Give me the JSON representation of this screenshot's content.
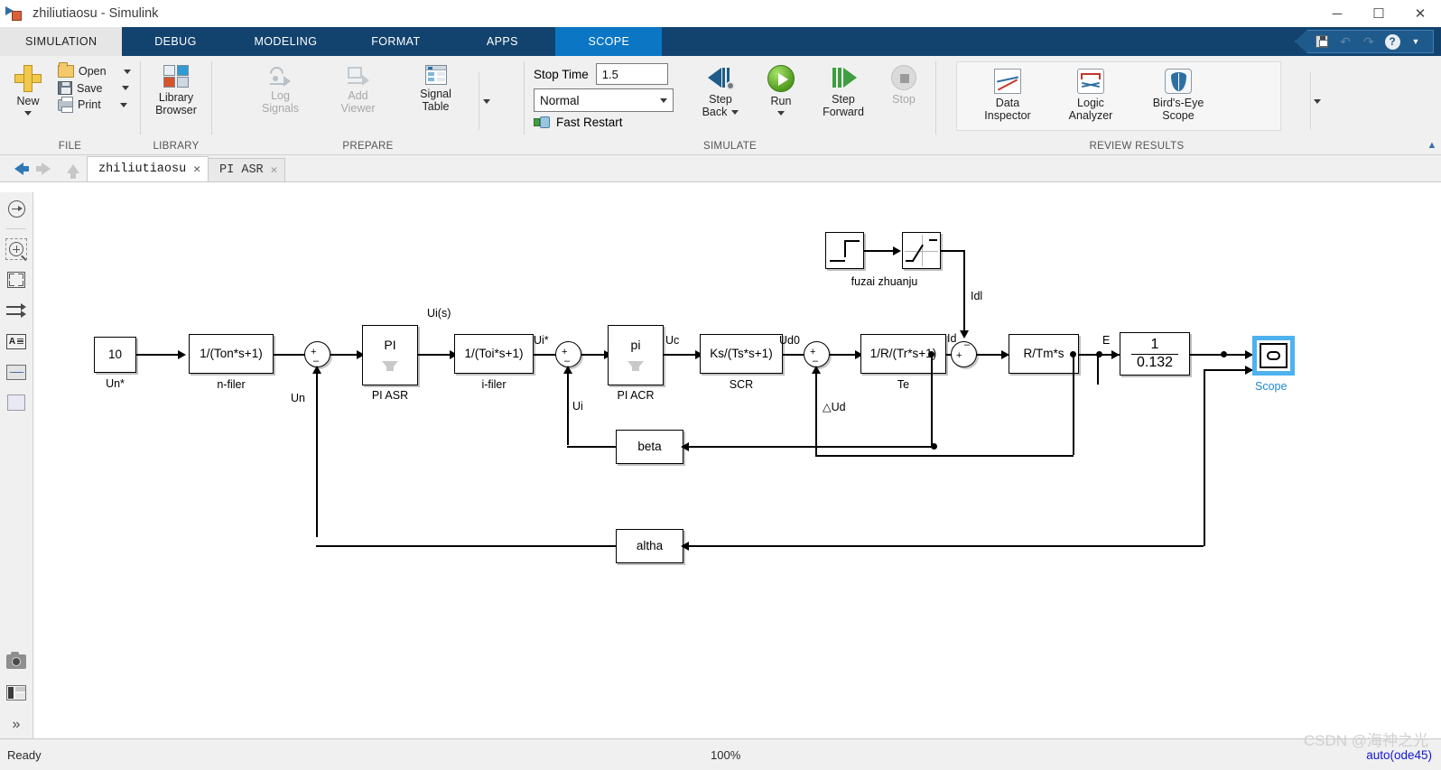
{
  "window": {
    "title": "zhiliutiaosu - Simulink",
    "minimize": "─",
    "maximize": "☐",
    "close": "✕"
  },
  "quick_access": {
    "save": "save-icon",
    "undo": "↶",
    "redo": "↷",
    "help": "?",
    "more": "▼"
  },
  "ribbon_tabs": [
    {
      "label": "SIMULATION",
      "state": "active"
    },
    {
      "label": "DEBUG",
      "state": "normal"
    },
    {
      "label": "MODELING",
      "state": "normal"
    },
    {
      "label": "FORMAT",
      "state": "normal"
    },
    {
      "label": "APPS",
      "state": "normal"
    },
    {
      "label": "SCOPE",
      "state": "contextual"
    }
  ],
  "ribbon": {
    "file": {
      "title": "FILE",
      "new": "New",
      "open": "Open",
      "save": "Save",
      "print": "Print"
    },
    "library": {
      "title": "LIBRARY",
      "browser_line1": "Library",
      "browser_line2": "Browser"
    },
    "prepare": {
      "title": "PREPARE",
      "log_line1": "Log",
      "log_line2": "Signals",
      "viewer_line1": "Add",
      "viewer_line2": "Viewer",
      "table_line1": "Signal",
      "table_line2": "Table"
    },
    "simulate": {
      "title": "SIMULATE",
      "stop_time_label": "Stop Time",
      "stop_time_value": "1.5",
      "mode_value": "Normal",
      "fast_restart": "Fast Restart",
      "step_back_line1": "Step",
      "step_back_line2": "Back",
      "run": "Run",
      "step_forward_line1": "Step",
      "step_forward_line2": "Forward",
      "stop": "Stop"
    },
    "review": {
      "title": "REVIEW RESULTS",
      "data_inspector_line1": "Data",
      "data_inspector_line2": "Inspector",
      "logic_analyzer_line1": "Logic",
      "logic_analyzer_line2": "Analyzer",
      "birds_eye_line1": "Bird's-Eye",
      "birds_eye_line2": "Scope"
    }
  },
  "model_tabs": [
    {
      "label": "zhiliutiaosu",
      "close": "✕",
      "active": true
    },
    {
      "label": "PI ASR",
      "close": "✕",
      "active": false
    }
  ],
  "palette": [
    {
      "name": "navigate-icon"
    },
    {
      "name": "zoom-icon"
    },
    {
      "name": "fit-to-view-icon"
    },
    {
      "name": "signal-routing-icon"
    },
    {
      "name": "annotation-icon"
    },
    {
      "name": "viewer-icon"
    },
    {
      "name": "area-icon"
    },
    {
      "name": "camera-icon"
    },
    {
      "name": "template-icon"
    },
    {
      "name": "expand-icon"
    }
  ],
  "diagram": {
    "blocks": [
      {
        "id": "un_star",
        "text": "10",
        "label": "Un*"
      },
      {
        "id": "n_filter",
        "text": "1/(Ton*s+1)",
        "label": "n-filer"
      },
      {
        "id": "pi_asr",
        "text": "PI",
        "label": "PI ASR"
      },
      {
        "id": "i_filter",
        "text": "1/(Toi*s+1)",
        "label": "i-filer"
      },
      {
        "id": "pi_acr",
        "text": "pi",
        "label": "PI ACR"
      },
      {
        "id": "scr",
        "text": "Ks/(Ts*s+1)",
        "label": "SCR"
      },
      {
        "id": "te",
        "text": "1/R/(Tr*s+1)",
        "label": "Te"
      },
      {
        "id": "rtms",
        "text": "R/Tm*s",
        "label": ""
      },
      {
        "id": "ce_gain_num",
        "text": "1",
        "label": ""
      },
      {
        "id": "ce_gain_den",
        "text": "0.132",
        "label": ""
      },
      {
        "id": "beta",
        "text": "beta",
        "label": ""
      },
      {
        "id": "altha",
        "text": "altha",
        "label": ""
      },
      {
        "id": "step",
        "text": "",
        "label": "fuzai zhuanju"
      },
      {
        "id": "saturation",
        "text": "",
        "label": ""
      },
      {
        "id": "scope",
        "text": "",
        "label": "Scope"
      }
    ],
    "signal_labels": [
      {
        "id": "un_fb",
        "text": "Un"
      },
      {
        "id": "ui_s",
        "text": "Ui(s)"
      },
      {
        "id": "ui_ref",
        "text": "Ui*"
      },
      {
        "id": "ui_fb",
        "text": "Ui"
      },
      {
        "id": "uc",
        "text": "Uc"
      },
      {
        "id": "ud0",
        "text": "Ud0"
      },
      {
        "id": "delta_ud",
        "text": "△Ud"
      },
      {
        "id": "id",
        "text": "Id"
      },
      {
        "id": "idl",
        "text": "Idl"
      },
      {
        "id": "e",
        "text": "E"
      }
    ],
    "sum_signs": {
      "plus": "+",
      "minus": "–"
    },
    "scope_label_color": "#1f8ad6",
    "selection_color": "#4db2ef"
  },
  "status": {
    "ready": "Ready",
    "zoom": "100%",
    "solver": "auto(ode45)",
    "watermark": "CSDN @海神之光"
  }
}
